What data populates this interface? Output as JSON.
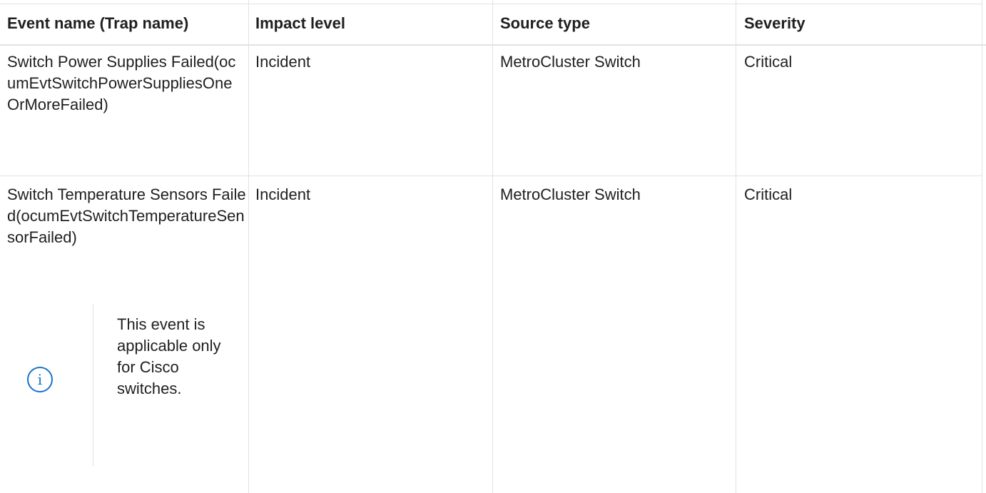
{
  "table": {
    "headers": {
      "event": "Event name (Trap name)",
      "impact": "Impact level",
      "source": "Source type",
      "severity": "Severity"
    },
    "rows": [
      {
        "event": "Switch Power Supplies Failed(ocumEvtSwitchPowerSuppliesOneOrMoreFailed)",
        "impact": "Incident",
        "source": "MetroCluster Switch",
        "severity": "Critical"
      },
      {
        "event": "Switch Temperature Sensors Failed(ocumEvtSwitchTemperatureSensorFailed)",
        "impact": "Incident",
        "source": "MetroCluster Switch",
        "severity": "Critical",
        "note": "This event is applicable only for Cisco switches."
      }
    ]
  },
  "icons": {
    "note_icon": "info-icon",
    "accent_color": "#1a73c8"
  }
}
